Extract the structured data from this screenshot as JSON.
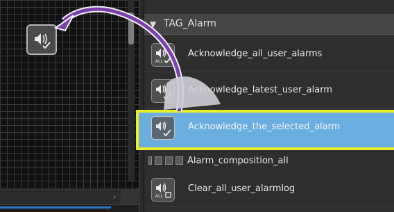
{
  "panel": {
    "group_title": "TAG_Alarm",
    "items": [
      {
        "label": "Acknowledge_all_user_alarms",
        "icon": "speaker-check-all-icon"
      },
      {
        "label": "Acknowledge_latest_user_alarm",
        "icon": "speaker-check-icon"
      },
      {
        "label": "Acknowledge_the_selected_alarm",
        "icon": "speaker-check-icon",
        "selected": true
      },
      {
        "label": "Alarm_composition_all",
        "icon": "alarm-composition-icons"
      },
      {
        "label": "Clear_all_user_alarmlog",
        "icon": "speaker-clear-all-icon"
      }
    ]
  },
  "canvas": {
    "placed_icon": "speaker-check-icon"
  },
  "colors": {
    "selection_fill": "#6aaee0",
    "selection_border": "#ecec2a",
    "arrow": "#7b3fb0"
  }
}
